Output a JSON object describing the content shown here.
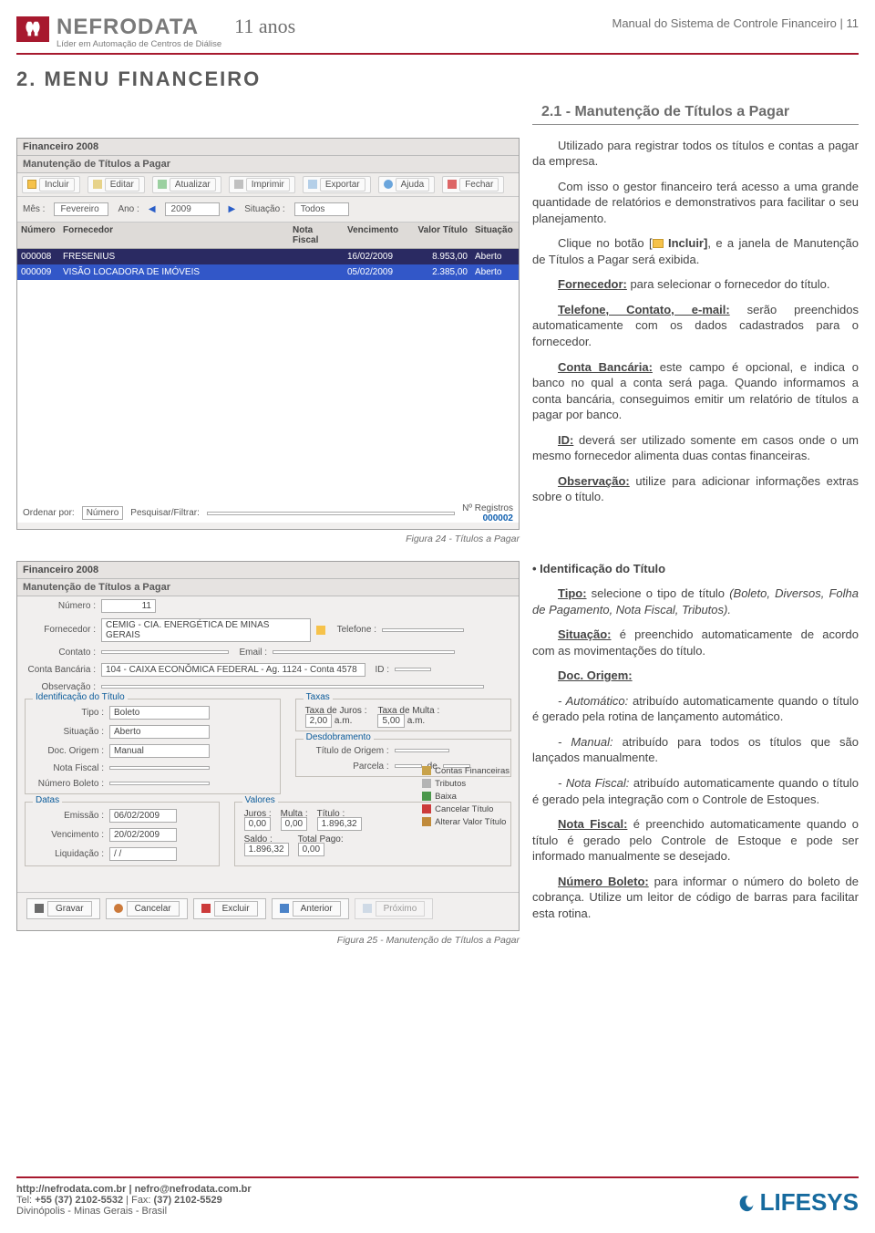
{
  "brand": {
    "name": "NEFRODATA",
    "tagline": "Líder em Automação de Centros de Diálise",
    "anos": "11 anos"
  },
  "doc_header": "Manual do Sistema de Controle Financeiro | 11",
  "section_title": "2. MENU FINANCEIRO",
  "subheading": "2.1 - Manutenção de Títulos a Pagar",
  "fig1_caption": "Figura 24 - Títulos a Pagar",
  "fig2_caption": "Figura 25 - Manutenção de Títulos a Pagar",
  "ss1": {
    "window_title": "Financeiro 2008",
    "subtitle": "Manutenção de Títulos a Pagar",
    "toolbar": [
      "Incluir",
      "Editar",
      "Atualizar",
      "Imprimir",
      "Exportar",
      "Ajuda",
      "Fechar"
    ],
    "filters": {
      "mes_lbl": "Mês :",
      "mes": "Fevereiro",
      "ano_lbl": "Ano :",
      "ano": "2009",
      "sit_lbl": "Situação :",
      "sit": "Todos"
    },
    "cols": {
      "num": "Número",
      "forn": "Fornecedor",
      "nf": "Nota Fiscal",
      "venc": "Vencimento",
      "val": "Valor Título",
      "sit": "Situação"
    },
    "rows": [
      {
        "num": "000008",
        "forn": "FRESENIUS",
        "nf": "",
        "venc": "16/02/2009",
        "val": "8.953,00",
        "sit": "Aberto"
      },
      {
        "num": "000009",
        "forn": "VISÃO LOCADORA DE IMÓVEIS",
        "nf": "",
        "venc": "05/02/2009",
        "val": "2.385,00",
        "sit": "Aberto"
      }
    ],
    "footer": {
      "ordenar_lbl": "Ordenar por:",
      "ordenar": "Número",
      "pesquisar_lbl": "Pesquisar/Filtrar:",
      "nreg_lbl": "Nº Registros",
      "nreg": "000002"
    }
  },
  "ss2": {
    "window_title": "Financeiro 2008",
    "subtitle": "Manutenção de Títulos a Pagar",
    "numero_lbl": "Número :",
    "numero": "11",
    "fornecedor_lbl": "Fornecedor :",
    "fornecedor": "CEMIG - CIA. ENERGÉTICA DE MINAS GERAIS",
    "telefone_lbl": "Telefone :",
    "contato_lbl": "Contato :",
    "email_lbl": "Email :",
    "contabanc_lbl": "Conta Bancária :",
    "contabanc": "104 - CAIXA ECONÔMICA FEDERAL - Ag. 1124 - Conta 4578",
    "id_lbl": "ID :",
    "obs_lbl": "Observação :",
    "ident_legend": "Identificação do Título",
    "tipo_lbl": "Tipo :",
    "tipo": "Boleto",
    "sit_lbl": "Situação :",
    "sit": "Aberto",
    "doc_lbl": "Doc. Origem :",
    "doc": "Manual",
    "nf_lbl": "Nota Fiscal :",
    "numb_lbl": "Número Boleto :",
    "taxas_legend": "Taxas",
    "taxa_juros_lbl": "Taxa de Juros :",
    "taxa_juros": "2,00",
    "am1": "a.m.",
    "taxa_multa_lbl": "Taxa de Multa :",
    "taxa_multa": "5,00",
    "am2": "a.m.",
    "desd_legend": "Desdobramento",
    "tit_orig_lbl": "Título de Origem :",
    "parc_lbl": "Parcela :",
    "de": "de",
    "datas_legend": "Datas",
    "emissao_lbl": "Emissão :",
    "emissao": "06/02/2009",
    "venc_lbl": "Vencimento :",
    "venc": "20/02/2009",
    "liq_lbl": "Liquidação :",
    "liq": "/ /",
    "valores_legend": "Valores",
    "juros_lbl": "Juros :",
    "juros": "0,00",
    "multa_lbl": "Multa :",
    "multa": "0,00",
    "titulo_lbl": "Título :",
    "titulo": "1.896,32",
    "saldo_lbl": "Saldo :",
    "saldo": "1.896,32",
    "totpago_lbl": "Total Pago:",
    "totpago": "0,00",
    "actions": [
      "Contas Financeiras",
      "Tributos",
      "Baixa",
      "Cancelar Título",
      "Alterar Valor Título"
    ],
    "buttons": [
      "Gravar",
      "Cancelar",
      "Excluir",
      "Anterior",
      "Próximo"
    ]
  },
  "body": {
    "p1_a": "Utilizado para registrar todos os títulos e contas a pagar da empresa.",
    "p2": "Com isso o gestor financeiro terá acesso a uma grande quantidade de relatórios e demonstrativos para facilitar o seu planejamento.",
    "p3_a": "Clique no botão [",
    "p3_b": " Incluir]",
    "p3_c": ", e a janela de Manutenção de Títulos a Pagar será exibida.",
    "p4_l": "Fornecedor:",
    "p4_r": " para selecionar o fornecedor do título.",
    "p5_l": "Telefone, Contato, e-mail:",
    "p5_r": " serão preenchidos automaticamente com os dados cadastrados para o fornecedor.",
    "p6_l": "Conta Bancária:",
    "p6_r": " este campo é opcional, e indica o banco no qual a conta será paga. Quando informamos a conta bancária, conseguimos emitir um relatório de títulos a pagar por banco.",
    "p7_l": "ID:",
    "p7_r": " deverá ser utilizado somente em casos onde o um mesmo fornecedor alimenta duas contas financeiras.",
    "p8_l": "Observação:",
    "p8_r": " utilize para adicionar informações extras sobre o título.",
    "p9_h": "• Identificação do Título",
    "p10_l": "Tipo:",
    "p10_r": " selecione o tipo de título ",
    "p10_i": "(Boleto, Diversos, Folha de Pagamento, Nota Fiscal, Tributos).",
    "p11_l": "Situação:",
    "p11_r": " é preenchido automaticamente de acordo com as movimentações do título.",
    "p12_l": "Doc. Origem:",
    "p12a_i": "- Automático:",
    "p12a_r": " atribuído automaticamente quando o título é gerado pela rotina de lançamento automático.",
    "p12b_i": "- Manual:",
    "p12b_r": " atribuído para todos os títulos que são lançados manualmente.",
    "p12c_i": "- Nota Fiscal:",
    "p12c_r": " atribuído automaticamente quando o título é gerado pela integração com o Controle de Estoques.",
    "p13_l": "Nota Fiscal:",
    "p13_r": " é preenchido automaticamente quando o título é gerado pelo Controle de Estoque e pode ser informado manualmente se desejado.",
    "p14_l": "Número Boleto:",
    "p14_r": " para informar o número do boleto de cobrança. Utilize um leitor de código de barras para facilitar esta rotina."
  },
  "footer": {
    "l1": "http://nefrodata.com.br | nefro@nefrodata.com.br",
    "l2a": "Tel: ",
    "l2b": "+55 (37) 2102-5532",
    "l2c": " | Fax: ",
    "l2d": "(37) 2102-5529",
    "l3": "Divinópolis     -     Minas Gerais     -     Brasil",
    "brand2": "LIFESYS"
  }
}
